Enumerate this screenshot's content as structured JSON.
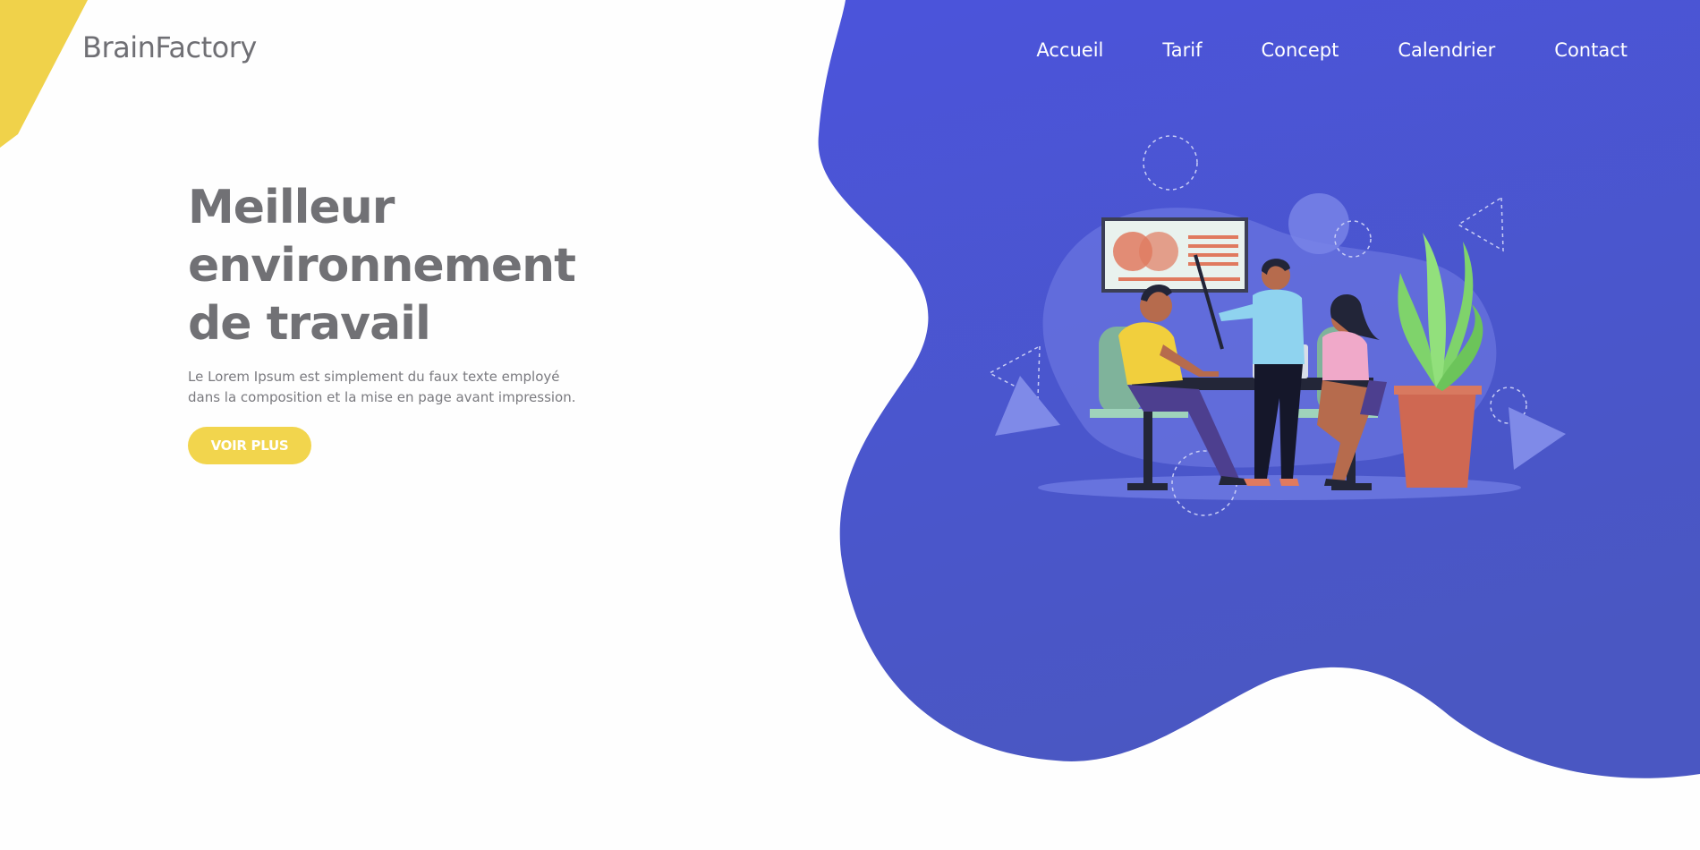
{
  "brand": {
    "logo_text": "BrainFactory"
  },
  "nav": {
    "items": [
      {
        "label": "Accueil"
      },
      {
        "label": "Tarif"
      },
      {
        "label": "Concept"
      },
      {
        "label": "Calendrier"
      },
      {
        "label": "Contact"
      }
    ]
  },
  "hero": {
    "title_lines": [
      "Meilleur",
      "environnement",
      "de travail"
    ],
    "description_lines": [
      "Le Lorem Ipsum est simplement du faux texte employé",
      "dans la composition et la mise en page avant impression."
    ],
    "cta_label": "VOIR PLUS"
  },
  "colors": {
    "accent_yellow": "#f2d54d",
    "blob_blue": "#4a55d6",
    "text_gray": "#717175",
    "nav_text": "#ffffff"
  },
  "icons": {
    "illustration": "team-meeting-illustration"
  }
}
